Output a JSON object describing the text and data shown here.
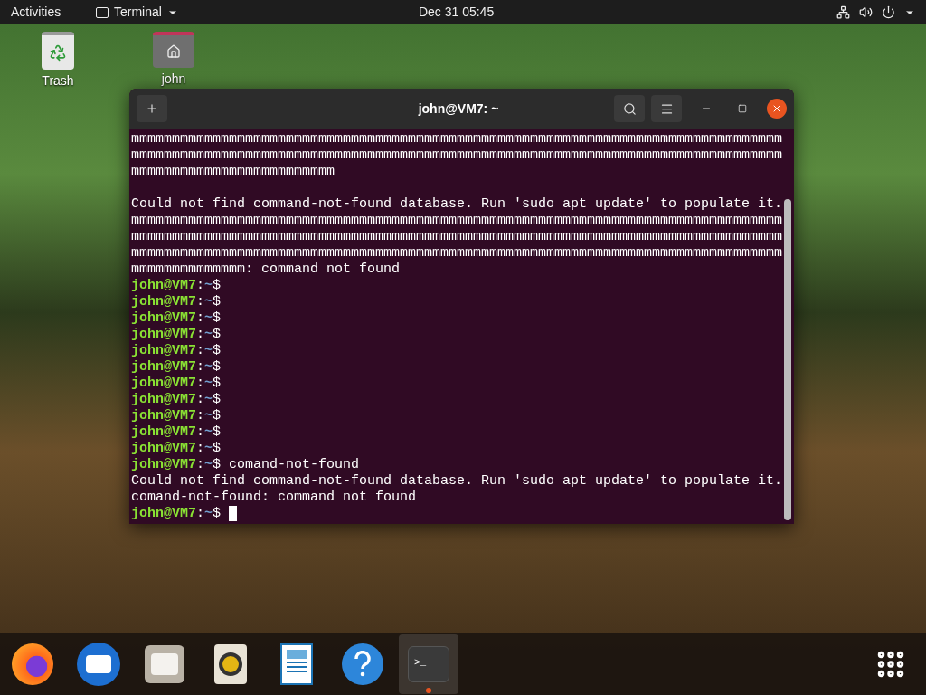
{
  "top_bar": {
    "activities": "Activities",
    "app_menu": "Terminal",
    "clock": "Dec 31  05:45"
  },
  "desktop_icons": [
    {
      "kind": "trash",
      "label": "Trash"
    },
    {
      "kind": "home",
      "label": "john"
    }
  ],
  "terminal": {
    "title": "john@VM7: ~",
    "lines": [
      {
        "kind": "output",
        "text": "mmmmmmmmmmmmmmmmmmmmmmmmmmmmmmmmmmmmmmmmmmmmmmmmmmmmmmmmmmmmmmmmmmmmmmmmmmmmmmmm"
      },
      {
        "kind": "output",
        "text": "mmmmmmmmmmmmmmmmmmmmmmmmmmmmmmmmmmmmmmmmmmmmmmmmmmmmmmmmmmmmmmmmmmmmmmmmmmmmmmmm"
      },
      {
        "kind": "output",
        "text": "mmmmmmmmmmmmmmmmmmmmmmmmm"
      },
      {
        "kind": "blank"
      },
      {
        "kind": "output",
        "text": "Could not find command-not-found database. Run 'sudo apt update' to populate it."
      },
      {
        "kind": "output",
        "text": "mmmmmmmmmmmmmmmmmmmmmmmmmmmmmmmmmmmmmmmmmmmmmmmmmmmmmmmmmmmmmmmmmmmmmmmmmmmmmmmm"
      },
      {
        "kind": "output",
        "text": "mmmmmmmmmmmmmmmmmmmmmmmmmmmmmmmmmmmmmmmmmmmmmmmmmmmmmmmmmmmmmmmmmmmmmmmmmmmmmmmm"
      },
      {
        "kind": "output",
        "text": "mmmmmmmmmmmmmmmmmmmmmmmmmmmmmmmmmmmmmmmmmmmmmmmmmmmmmmmmmmmmmmmmmmmmmmmmmmmmmmmm"
      },
      {
        "kind": "output",
        "text": "mmmmmmmmmmmmmm: command not found"
      },
      {
        "kind": "prompt",
        "user": "john@VM7",
        "sep": ":",
        "path": "~$"
      },
      {
        "kind": "prompt",
        "user": "john@VM7",
        "sep": ":",
        "path": "~$"
      },
      {
        "kind": "prompt",
        "user": "john@VM7",
        "sep": ":",
        "path": "~$"
      },
      {
        "kind": "prompt",
        "user": "john@VM7",
        "sep": ":",
        "path": "~$"
      },
      {
        "kind": "prompt",
        "user": "john@VM7",
        "sep": ":",
        "path": "~$"
      },
      {
        "kind": "prompt",
        "user": "john@VM7",
        "sep": ":",
        "path": "~$"
      },
      {
        "kind": "prompt",
        "user": "john@VM7",
        "sep": ":",
        "path": "~$"
      },
      {
        "kind": "prompt",
        "user": "john@VM7",
        "sep": ":",
        "path": "~$"
      },
      {
        "kind": "prompt",
        "user": "john@VM7",
        "sep": ":",
        "path": "~$"
      },
      {
        "kind": "prompt",
        "user": "john@VM7",
        "sep": ":",
        "path": "~$"
      },
      {
        "kind": "prompt",
        "user": "john@VM7",
        "sep": ":",
        "path": "~$"
      },
      {
        "kind": "prompt",
        "user": "john@VM7",
        "sep": ":",
        "path": "~$",
        "command": "comand-not-found"
      },
      {
        "kind": "output",
        "text": "Could not find command-not-found database. Run 'sudo apt update' to populate it."
      },
      {
        "kind": "output",
        "text": "comand-not-found: command not found"
      },
      {
        "kind": "prompt",
        "user": "john@VM7",
        "sep": ":",
        "path": "~$",
        "cursor": true
      }
    ]
  },
  "dock": [
    {
      "kind": "firefox",
      "running": false
    },
    {
      "kind": "mail",
      "running": false
    },
    {
      "kind": "files",
      "running": false
    },
    {
      "kind": "music",
      "running": false
    },
    {
      "kind": "writer",
      "running": false
    },
    {
      "kind": "help",
      "running": false
    },
    {
      "kind": "terminal",
      "running": true,
      "label": ">_"
    }
  ]
}
